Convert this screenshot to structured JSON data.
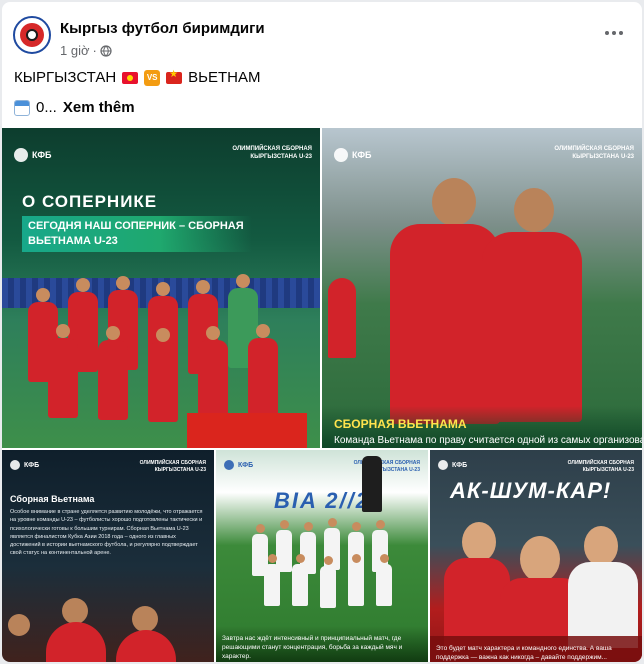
{
  "post": {
    "page_name": "Кыргыз футбол биримдиги",
    "time": "1 giờ",
    "privacy_separator": "·",
    "title_left": "КЫРГЫЗСТАН",
    "vs": "VS",
    "title_right": "ВЬЕТНАМ",
    "body_prefix": "0...",
    "see_more": "Xem thêm"
  },
  "photos": {
    "p1": {
      "logo": "КФБ",
      "tag": "ОЛИМПИЙСКАЯ СБОРНАЯ КЫРГЫЗСТАНА U-23",
      "title": "О СОПЕРНИКЕ",
      "subtitle": "СЕГОДНЯ НАШ СОПЕРНИК – СБОРНАЯ ВЬЕТНАМА U-23"
    },
    "p2": {
      "logo": "КФБ",
      "tag": "ОЛИМПИЙСКАЯ СБОРНАЯ КЫРГЫЗСТАНА U-23",
      "caption_title": "СБОРНАЯ ВЬЕТНАМА",
      "caption_text": "Команда Вьетнама по праву считается одной из самых организован..."
    },
    "p3": {
      "logo": "КФБ",
      "tag": "ОЛИМПИЙСКАЯ СБОРНАЯ КЫРГЫЗСТАНА U-23",
      "title": "Сборная Вьетнама",
      "text": "Особое внимание в стране уделяется развитию молодёжи, что отражается на уровне команды U-23 – футболисты хорошо подготовлены тактически и психологически готовы к большим турнирам. Сборная Вьетнама U-23 является финалистом Кубка Азии 2018 года – одного из главных достижений в истории вьетнамского футбола, и регулярно подтверждает свой статус на континентальной арене."
    },
    "p4": {
      "logo": "КФБ",
      "tag": "ОЛИМПИЙСКАЯ СБОРНАЯ КЫРГЫЗСТАНА U-23",
      "banner": "BIA 2//2",
      "caption": "Завтра нас ждёт интенсивный и принципиальный матч, где решающими станут концентрация, борьба за каждый мяч и характер."
    },
    "p5": {
      "logo": "КФБ",
      "tag": "ОЛИМПИЙСКАЯ СБОРНАЯ КЫРГЫЗСТАНА U-23",
      "title": "АК-ШУМ-КАР!",
      "caption": "Это будет матч характера и командного единства. А ваша поддержка — важна как никогда – давайте поддержим..."
    }
  },
  "icons": {
    "globe": "globe-icon",
    "more": "more-horizontal-icon",
    "calendar": "calendar-icon",
    "flag_kg": "flag-kyrgyzstan-icon",
    "flag_vn": "flag-vietnam-icon"
  },
  "colors": {
    "text_primary": "#050505",
    "text_secondary": "#65676b",
    "accent_green": "#1fa86e",
    "vietnam_red": "#da251d"
  }
}
